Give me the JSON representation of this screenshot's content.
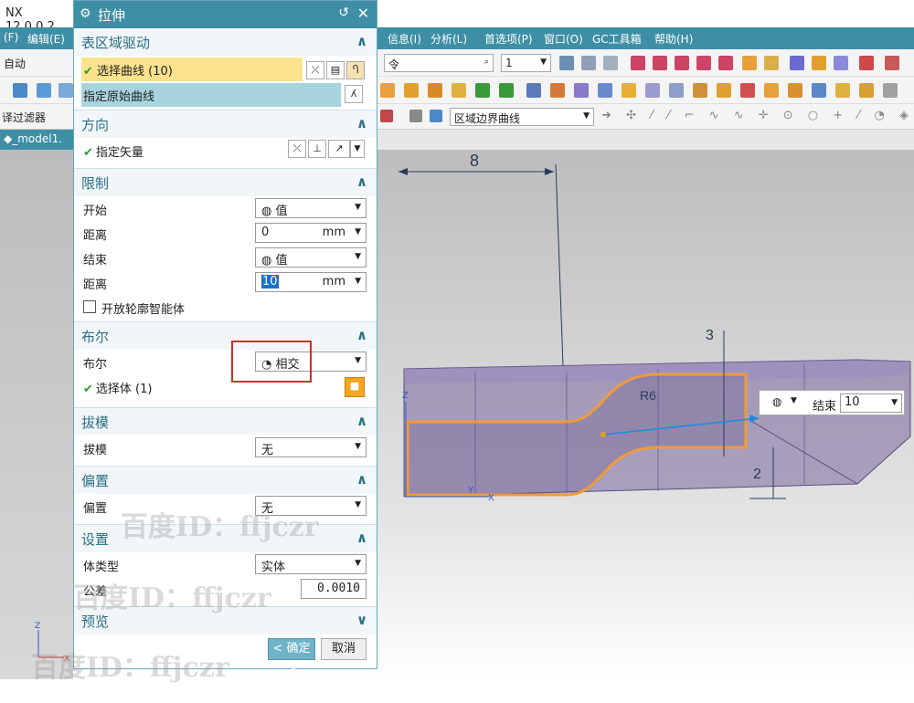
{
  "app": {
    "title": "NX 12.0.0.2"
  },
  "menus": {
    "left": [
      "(F)",
      "编辑(E)"
    ],
    "right": [
      "信息(I)",
      "分析(L)",
      "首选项(P)",
      "窗口(O)",
      "GC工具箱",
      "帮助(H)"
    ]
  },
  "toolbar": {
    "auto_label": "自动",
    "command_search": "令",
    "layer_value": "1",
    "filter_label": "译过滤器",
    "curve_rule": "区域边界曲线"
  },
  "tab": {
    "model_name": "_model1."
  },
  "dialog": {
    "title": "拉伸",
    "sections": {
      "region": {
        "title": "表区域驱动",
        "select_curve": "选择曲线 (10)",
        "specify_curve": "指定原始曲线"
      },
      "direction": {
        "title": "方向",
        "specify_vector": "指定矢量"
      },
      "limits": {
        "title": "限制",
        "start_label": "开始",
        "start_value": "值",
        "start_dist_label": "距离",
        "start_dist": "0",
        "start_unit": "mm",
        "end_label": "结束",
        "end_value": "值",
        "end_dist_label": "距离",
        "end_dist": "10",
        "end_unit": "mm",
        "open_profile": "开放轮廓智能体"
      },
      "boolean": {
        "title": "布尔",
        "boolean_label": "布尔",
        "boolean_value": "相交",
        "select_body": "选择体 (1)"
      },
      "draft": {
        "title": "拔模",
        "draft_label": "拔模",
        "draft_value": "无"
      },
      "offset": {
        "title": "偏置",
        "offset_label": "偏置",
        "offset_value": "无"
      },
      "settings": {
        "title": "设置",
        "body_type_label": "体类型",
        "body_type_value": "实体",
        "tolerance_label": "公差",
        "tolerance_value": "0.0010"
      },
      "preview": {
        "title": "预览"
      }
    },
    "ok_label": "< 确定 >",
    "cancel_label": "取消"
  },
  "canvas": {
    "dim_top": "8",
    "dim_right": "3",
    "dim_diag": "R6",
    "dim_bottom": "2",
    "axis_z": "Z",
    "axis_y": "Y",
    "axis_x": "X",
    "callout_label": "结束",
    "callout_value": "10"
  },
  "watermark": "百度ID：ffjczr",
  "colors": {
    "accent": "#3e8fa6",
    "highlight_row": "#fbe38e",
    "section_title": "#2a6f85",
    "profile": "#f09a3e",
    "solid": "#7a6aa0",
    "annotation_red": "#d82a2a"
  }
}
